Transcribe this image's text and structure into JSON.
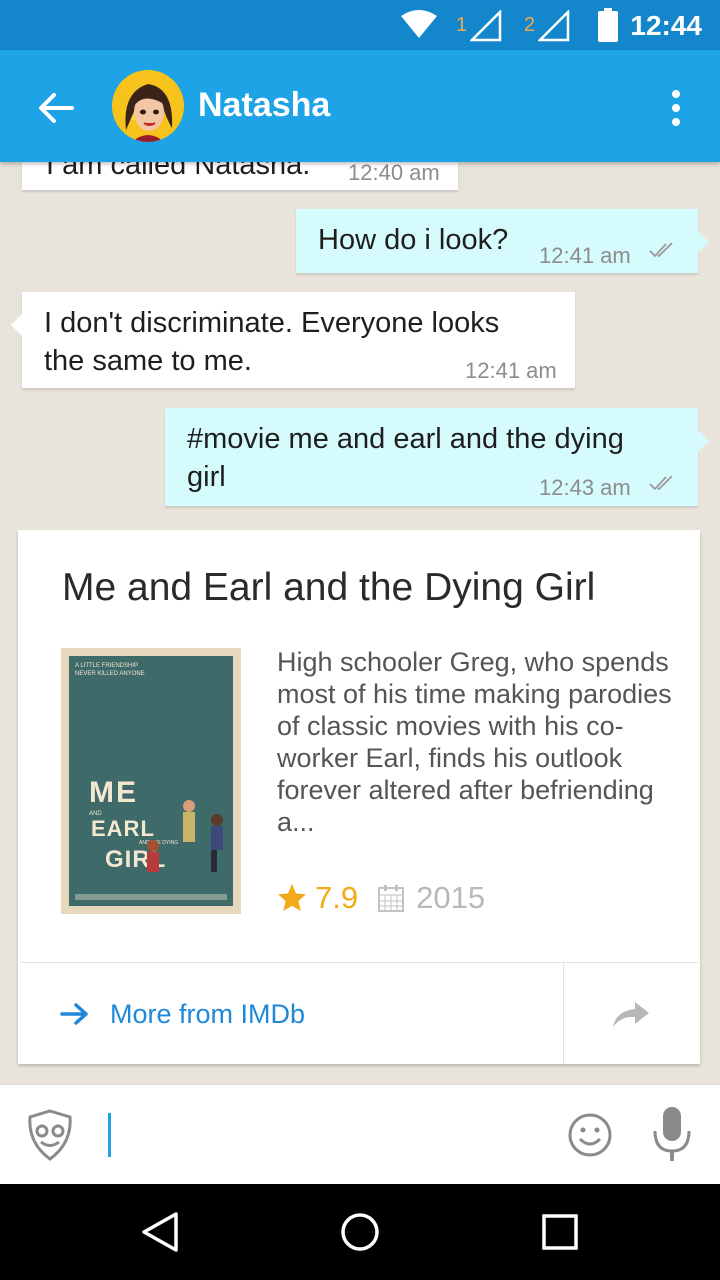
{
  "status_bar": {
    "time": "12:44",
    "sim1_label": "1",
    "sim2_label": "2",
    "icons": [
      "wifi-icon",
      "signal-sim1-icon",
      "signal-sim2-icon",
      "battery-icon"
    ]
  },
  "header": {
    "contact_name": "Natasha",
    "back_icon": "arrow-back-icon",
    "menu_icon": "more-vert-icon"
  },
  "messages": [
    {
      "direction": "in",
      "text": "I am called Natasha.",
      "time": "12:40 am"
    },
    {
      "direction": "out",
      "text": "How do i look?",
      "time": "12:41 am",
      "status": "double-check-icon"
    },
    {
      "direction": "in",
      "text_line1": "I don't discriminate. Everyone looks",
      "text_line2": "the same to me.",
      "time": "12:41 am"
    },
    {
      "direction": "out",
      "text_line1": "#movie me and earl and the dying",
      "text_line2": "girl",
      "time": "12:43 am",
      "status": "double-check-icon"
    }
  ],
  "movie_card": {
    "title": "Me and Earl and the Dying Girl",
    "synopsis": "High schooler Greg, who spends most of his time making parodies of classic movies with his co-worker Earl, finds his outlook forever altered after befriending a...",
    "rating": "7.9",
    "year": "2015",
    "more_link_label": "More from IMDb",
    "poster": {
      "tagline": "A LITTLE FRIENDSHIP NEVER KILLED ANYONE",
      "me": "ME",
      "earl": "EARL",
      "girl": "GIRL",
      "and": "AND",
      "and_the_dying": "AND THE DYING"
    }
  },
  "input_bar": {
    "value": "",
    "placeholder": ""
  },
  "colors": {
    "app_bar": "#1ea3e6",
    "status_bar": "#1487cc",
    "background": "#e8e4dc",
    "outgoing_bubble": "#d6fbfd",
    "accent": "#1e88d9",
    "rating_star": "#f2a91a"
  }
}
